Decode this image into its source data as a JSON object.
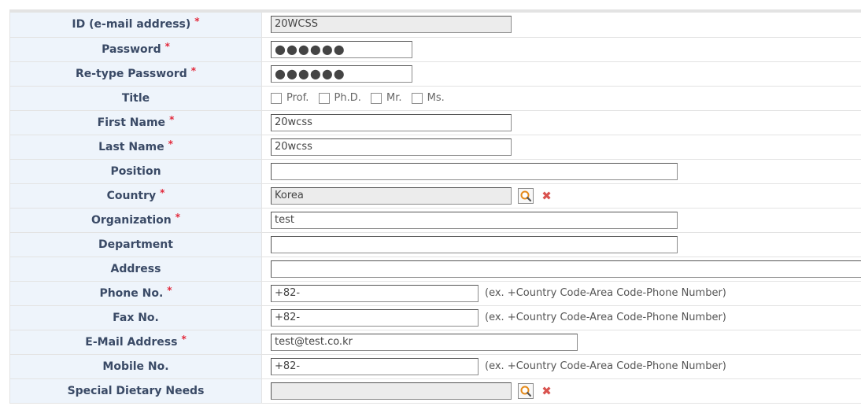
{
  "form": {
    "id": {
      "label": "ID (e-mail address)",
      "value": "20WCSS"
    },
    "password": {
      "label": "Password",
      "value": "●●●●●●"
    },
    "retype_password": {
      "label": "Re-type Password",
      "value": "●●●●●●"
    },
    "title": {
      "label": "Title",
      "options": [
        "Prof.",
        "Ph.D.",
        "Mr.",
        "Ms."
      ]
    },
    "first_name": {
      "label": "First Name",
      "value": "20wcss"
    },
    "last_name": {
      "label": "Last Name",
      "value": "20wcss"
    },
    "position": {
      "label": "Position",
      "value": ""
    },
    "country": {
      "label": "Country",
      "value": "Korea"
    },
    "organization": {
      "label": "Organization",
      "value": "test"
    },
    "department": {
      "label": "Department",
      "value": ""
    },
    "address": {
      "label": "Address",
      "value": ""
    },
    "phone": {
      "label": "Phone No.",
      "value": "+82-",
      "hint": "(ex. +Country Code-Area Code-Phone Number)"
    },
    "fax": {
      "label": "Fax No.",
      "value": "+82-",
      "hint": "(ex. +Country Code-Area Code-Phone Number)"
    },
    "email": {
      "label": "E-Mail Address",
      "value": "test@test.co.kr"
    },
    "mobile": {
      "label": "Mobile No.",
      "value": "+82-",
      "hint": "(ex. +Country Code-Area Code-Phone Number)"
    },
    "dietary": {
      "label": "Special Dietary Needs",
      "value": ""
    },
    "required_mark": "*"
  },
  "icons": {
    "search": "magnifier-icon",
    "clear": "red-x-icon"
  },
  "colors": {
    "label_bg": "#eef4fb",
    "label_text": "#3a4a66",
    "required": "#e2283a",
    "readonly_bg": "#ececec"
  }
}
